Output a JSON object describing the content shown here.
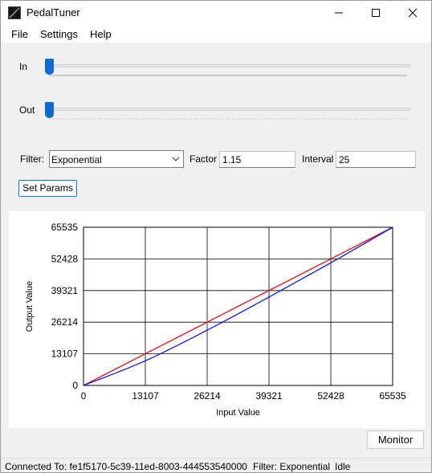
{
  "window": {
    "title": "PedalTuner"
  },
  "menu": {
    "file": "File",
    "settings": "Settings",
    "help": "Help"
  },
  "sliders": {
    "in_label": "In",
    "out_label": "Out",
    "in_value": 0,
    "out_value": 0
  },
  "filter": {
    "label": "Filter:",
    "selected": "Exponential",
    "factor_label": "Factor",
    "factor_value": "1.15",
    "interval_label": "Interval",
    "interval_value": "25",
    "set_params_label": "Set Params"
  },
  "chart_data": {
    "type": "line",
    "xlabel": "Input Value",
    "ylabel": "Output Value",
    "xlim": [
      0,
      65535
    ],
    "ylim": [
      0,
      65535
    ],
    "x_ticks": [
      0,
      13107,
      26214,
      39321,
      52428,
      65535
    ],
    "y_ticks": [
      0,
      13107,
      26214,
      39321,
      52428,
      65535
    ],
    "grid": true,
    "series": [
      {
        "color": "#e01010",
        "x": [
          0,
          13107,
          26214,
          39321,
          52428,
          65535
        ],
        "y": [
          0,
          13107,
          26214,
          39321,
          52428,
          65535
        ]
      },
      {
        "color": "#1414e0",
        "x": [
          0,
          13107,
          26214,
          39321,
          52428,
          65535
        ],
        "y": [
          0,
          10200,
          22900,
          36600,
          50800,
          65535
        ]
      }
    ]
  },
  "monitor_label": "Monitor",
  "status": {
    "connection": "Connected To: fe1f5170-5c39-11ed-8003-444553540000",
    "filter": "Filter: Exponential",
    "state": "Idle"
  }
}
